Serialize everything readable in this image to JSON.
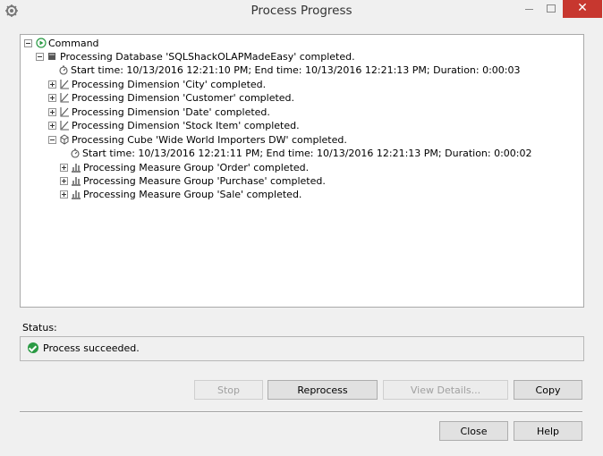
{
  "window": {
    "title": "Process Progress",
    "close_glyph": "✕"
  },
  "tree": {
    "command": "Command",
    "database": "Processing Database 'SQLShackOLAPMadeEasy' completed.",
    "db_time": "Start time: 10/13/2016 12:21:10 PM; End time: 10/13/2016 12:21:13 PM; Duration: 0:00:03",
    "dim_city": "Processing Dimension 'City' completed.",
    "dim_customer": "Processing Dimension 'Customer' completed.",
    "dim_date": "Processing Dimension 'Date' completed.",
    "dim_stock": "Processing Dimension 'Stock Item' completed.",
    "cube": "Processing Cube 'Wide World Importers DW' completed.",
    "cube_time": "Start time: 10/13/2016 12:21:11 PM; End time: 10/13/2016 12:21:13 PM; Duration: 0:00:02",
    "mg_order": "Processing Measure Group 'Order' completed.",
    "mg_purchase": "Processing Measure Group 'Purchase' completed.",
    "mg_sale": "Processing Measure Group 'Sale' completed."
  },
  "status": {
    "label": "Status:",
    "text": "Process succeeded."
  },
  "buttons": {
    "stop": "Stop",
    "reprocess": "Reprocess",
    "view_details": "View Details...",
    "copy": "Copy",
    "close": "Close",
    "help": "Help"
  },
  "icons": {
    "app": "settings-gear-icon",
    "command": "play-icon",
    "database": "database-cube-icon",
    "time": "stopwatch-icon",
    "dimension": "dimension-axis-icon",
    "cube": "cube-icon",
    "measure": "bar-chart-icon",
    "success": "check-circle-icon"
  },
  "colors": {
    "close_button": "#c7372f",
    "success": "#2a9a44",
    "command_play": "#2a9a44"
  }
}
